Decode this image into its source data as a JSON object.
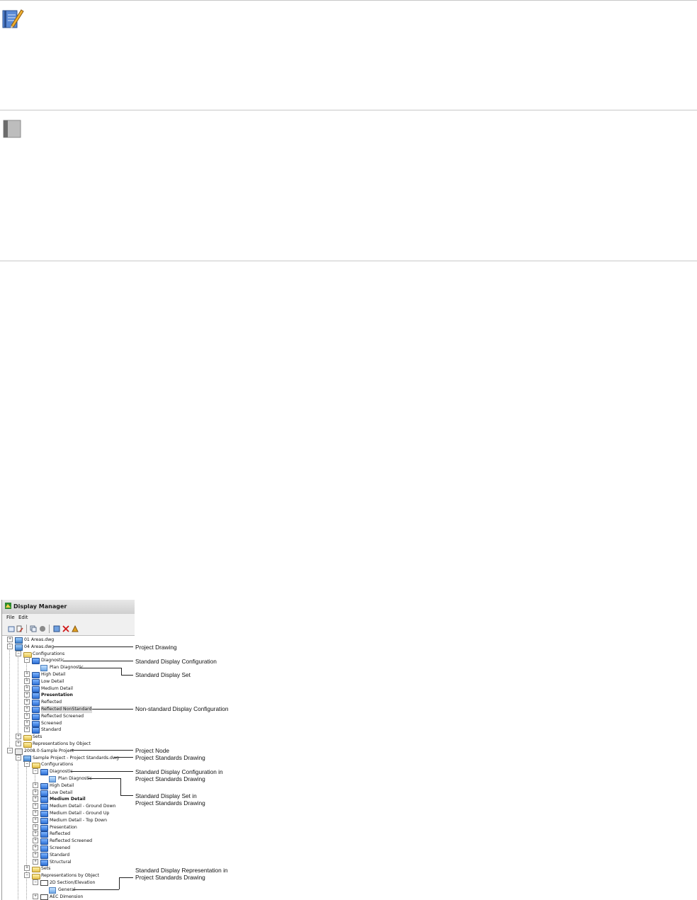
{
  "icons": {
    "note": "notepad-pencil-icon",
    "tip": "gray-block-icon"
  },
  "window": {
    "title": "Display Manager",
    "menu": [
      "File",
      "Edit"
    ],
    "toolbar": [
      "new-icon",
      "import-icon",
      "copy-icon",
      "paste-icon",
      "refresh-icon",
      "delete-icon",
      "purge-icon"
    ]
  },
  "tree": {
    "n01": "01 Areas.dwg",
    "n02": "04 Areas.dwg",
    "n03": "Configurations",
    "n04": "Diagnostic",
    "n05": "Plan Diagnostic",
    "n06": "High Detail",
    "n07": "Low Detail",
    "n08": "Medium Detail",
    "n09": "Presentation",
    "n10": "Reflected",
    "n11": "Reflected NonStandard",
    "n12": "Reflected Screened",
    "n13": "Screened",
    "n14": "Standard",
    "n15": "Sets",
    "n16": "Representations by Object",
    "n17": "2008.0-Sample Project",
    "n18": "Sample Project - Project Standards.dwg",
    "n19": "Configurations",
    "n20": "Diagnostic",
    "n21": "Plan Diagnostic",
    "n22": "High Detail",
    "n23": "Low Detail",
    "n24": "Medium Detail",
    "n25": "Medium Detail - Ground Down",
    "n26": "Medium Detail - Ground Up",
    "n27": "Medium Detail - Top Down",
    "n28": "Presentation",
    "n29": "Reflected",
    "n30": "Reflected Screened",
    "n31": "Screened",
    "n32": "Standard",
    "n33": "Structural",
    "n34": "Sets",
    "n35": "Representations by Object",
    "n36": "2D Section/Elevation",
    "n37": "General",
    "n38": "AEC Dimension"
  },
  "callouts": {
    "project_drawing": "Project Drawing",
    "std_display_config": "Standard Display Configuration",
    "std_display_set": "Standard Display Set",
    "nonstd_display_config": "Non-standard Display Configuration",
    "project_node": "Project Node",
    "project_standards_drawing": "Project Standards Drawing",
    "std_config_psd_1": "Standard Display Configuration in",
    "std_config_psd_2": "Project Standards Drawing",
    "std_set_psd_1": "Standard Display Set in",
    "std_set_psd_2": "Project Standards Drawing",
    "std_rep_psd_1": "Standard Display Representation in",
    "std_rep_psd_2": "Project Standards Drawing"
  },
  "colors": {
    "rule": "#c8c8c8",
    "config_icon": "#2d6fd4",
    "folder_icon": "#e5c34f",
    "delete_icon": "#d01818"
  }
}
